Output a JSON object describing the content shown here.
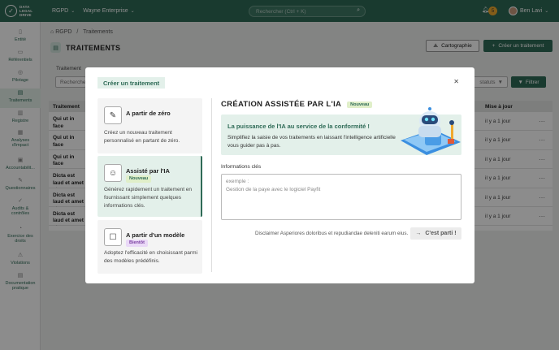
{
  "app": {
    "logo_lines": [
      "DATA",
      "LEGAL",
      "DRIVE"
    ],
    "nav_module": "RGPD",
    "nav_company": "Wayne Enterprise",
    "search_placeholder": "Rechercher (Ctrl + K)",
    "notif_count": "5",
    "user_name": "Ben Lavi"
  },
  "sidebar": {
    "items": [
      {
        "label": "Entité",
        "icon": "file-icon"
      },
      {
        "label": "Référentiels",
        "icon": "folder-icon"
      },
      {
        "label": "Pilotage",
        "icon": "compass-icon"
      },
      {
        "label": "Traitements",
        "icon": "document-icon",
        "active": true
      },
      {
        "label": "Registre",
        "icon": "register-icon"
      },
      {
        "label": "Analyses d'impact",
        "icon": "chart-icon"
      },
      {
        "label": "Accountabilit...",
        "icon": "cert-icon"
      },
      {
        "label": "Questionnaires",
        "icon": "edit-icon"
      },
      {
        "label": "Audits & contrôles",
        "icon": "check-icon"
      },
      {
        "label": "Exercice des droits",
        "icon": "rights-icon"
      },
      {
        "label": "Violations",
        "icon": "alert-icon"
      },
      {
        "label": "Documentation pratique",
        "icon": "book-icon"
      }
    ]
  },
  "page": {
    "breadcrumb_home": "RGPD",
    "breadcrumb_sep": "/",
    "breadcrumb_current": "Traitements",
    "title": "TRAITEMENTS",
    "btn_carto": "Cartographie",
    "btn_create": "Créer un traitement",
    "filter_label": "Traitement",
    "search_placeholder": "Recherche",
    "status_placeholder": "statuts",
    "btn_filter": "Filtrer"
  },
  "table": {
    "col_name": "Traitement",
    "col_updated": "Mise à jour",
    "rows": [
      {
        "name": "Qui ut in face",
        "updated": "il y a 1 jour"
      },
      {
        "name": "Qui ut in face",
        "updated": "il y a 1 jour"
      },
      {
        "name": "Qui ut in face",
        "updated": "il y a 1 jour"
      },
      {
        "name": "Dicta est laud et amet et es provident",
        "updated": "il y a 1 jour"
      },
      {
        "name": "Dicta est laud et amet et es provident",
        "updated": "il y a 1 jour"
      },
      {
        "name": "Dicta est laud et amet et es provident",
        "updated": "il y a 1 jour"
      }
    ]
  },
  "modal": {
    "title": "Créer un traitement",
    "options": [
      {
        "title": "A partir de zéro",
        "badge": "",
        "desc": "Créez un nouveau traitement personnalisé en partant de zéro.",
        "icon": "pen-icon"
      },
      {
        "title": "Assisté par l'IA",
        "badge": "Nouveau",
        "desc": "Générez rapidement un traitement en fournissant simplement quelques informations clés.",
        "icon": "robot-icon",
        "active": true
      },
      {
        "title": "A partir d'un modèle",
        "badge": "Bientôt",
        "desc": "Adoptez l'efficacité en choisissant parmi des modèles prédéfinis.",
        "icon": "template-icon"
      }
    ],
    "right_title": "CRÉATION ASSISTÉE PAR L'IA",
    "right_badge": "Nouveau",
    "banner_title": "La puissance de l'IA au service de la conformité !",
    "banner_desc": "Simplifiez la saisie de vos traitements en laissant l'intelligence artificielle vous guider pas à pas.",
    "field_label": "Informations clés",
    "field_placeholder": "exemple :\nGestion de la paye avec le logiciel Payfit",
    "disclaimer": "Disclaimer Asperiores doloribus et repudiandae deleniti earum eius.",
    "submit": "C'est parti !"
  },
  "colors": {
    "primary": "#2f6b57",
    "accent_bg": "#e3f0ea",
    "badge_new": "#e0efc9",
    "badge_soon": "#ead9f7",
    "notif": "#f0a92e"
  }
}
